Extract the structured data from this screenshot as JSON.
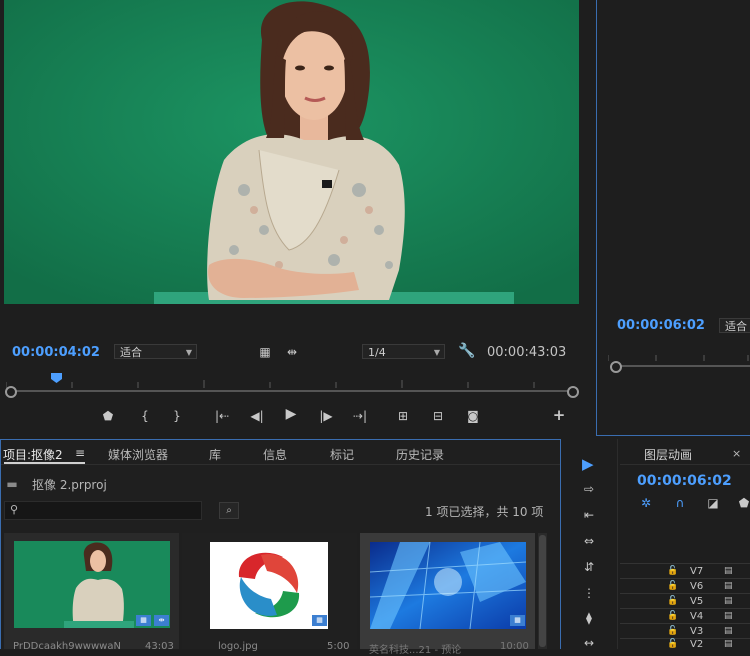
{
  "source_monitor": {
    "timecode_current": "00:00:04:02",
    "zoom": "适合",
    "resolution": "1/4",
    "timecode_duration": "00:00:43:03"
  },
  "program_monitor": {
    "timecode": "00:00:06:02",
    "zoom": "适合"
  },
  "project_panel": {
    "tabs": [
      "项目:抠像2",
      "媒体浏览器",
      "库",
      "信息",
      "标记",
      "历史记录"
    ],
    "menu_glyph": "≡",
    "project_file": "抠像 2.prproj",
    "search_placeholder": "",
    "selection_status": "1 项已选择，共 10 项",
    "items": [
      {
        "name": "PrDDcaakh9wwwwaN",
        "duration": "43:03"
      },
      {
        "name": "logo.jpg",
        "duration": "5:00"
      },
      {
        "name": "英名科技...21 - 预论",
        "duration": "10:00"
      }
    ]
  },
  "timeline_panel": {
    "title": "图层动画",
    "close": "×",
    "timecode": "00:00:06:02",
    "tracks": [
      "V7",
      "V6",
      "V5",
      "V4",
      "V3",
      "V2"
    ]
  },
  "icons": {
    "selection_tool": "▶",
    "track_select": "⇨",
    "ripple": "⇤",
    "roll": "⇔",
    "rate": "⇵",
    "razor": "⧫",
    "slip": "↔",
    "play": "▶",
    "add": "+"
  },
  "colors": {
    "accent_blue": "#4d9fff",
    "background": "#1e1e1e",
    "panel_border": "#3a6db0",
    "green_screen": "#1a8a5a"
  }
}
